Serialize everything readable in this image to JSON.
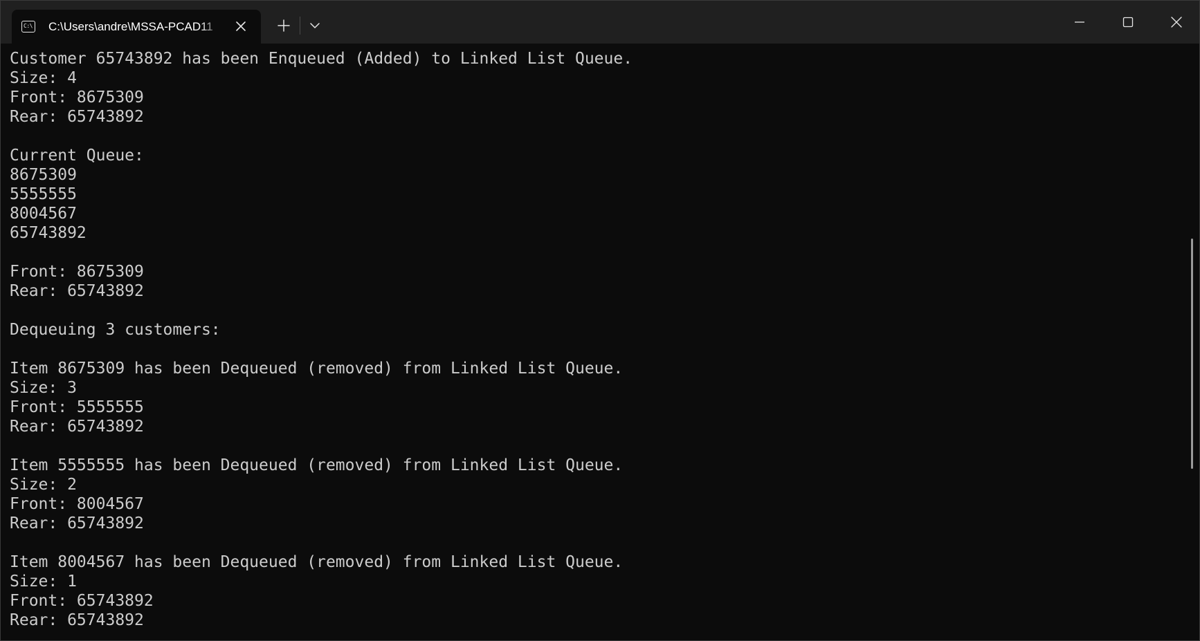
{
  "tab": {
    "title": "C:\\Users\\andre\\MSSA-PCAD11",
    "icon": "terminal-icon"
  },
  "toolbar": {
    "new_tab_icon": "plus-icon",
    "dropdown_icon": "chevron-down-icon"
  },
  "window_controls": {
    "minimize_icon": "minimize-icon",
    "maximize_icon": "maximize-icon",
    "close_icon": "close-icon"
  },
  "colors": {
    "background": "#0c0c0c",
    "titlebar": "#202020",
    "text": "#cccccc"
  },
  "terminal": {
    "lines": [
      "Customer 65743892 has been Enqueued (Added) to Linked List Queue.",
      "Size: 4",
      "Front: 8675309",
      "Rear: 65743892",
      "",
      "Current Queue:",
      "8675309",
      "5555555",
      "8004567",
      "65743892",
      "",
      "Front: 8675309",
      "Rear: 65743892",
      "",
      "Dequeuing 3 customers:",
      "",
      "Item 8675309 has been Dequeued (removed) from Linked List Queue.",
      "Size: 3",
      "Front: 5555555",
      "Rear: 65743892",
      "",
      "Item 5555555 has been Dequeued (removed) from Linked List Queue.",
      "Size: 2",
      "Front: 8004567",
      "Rear: 65743892",
      "",
      "Item 8004567 has been Dequeued (removed) from Linked List Queue.",
      "Size: 1",
      "Front: 65743892",
      "Rear: 65743892"
    ]
  }
}
